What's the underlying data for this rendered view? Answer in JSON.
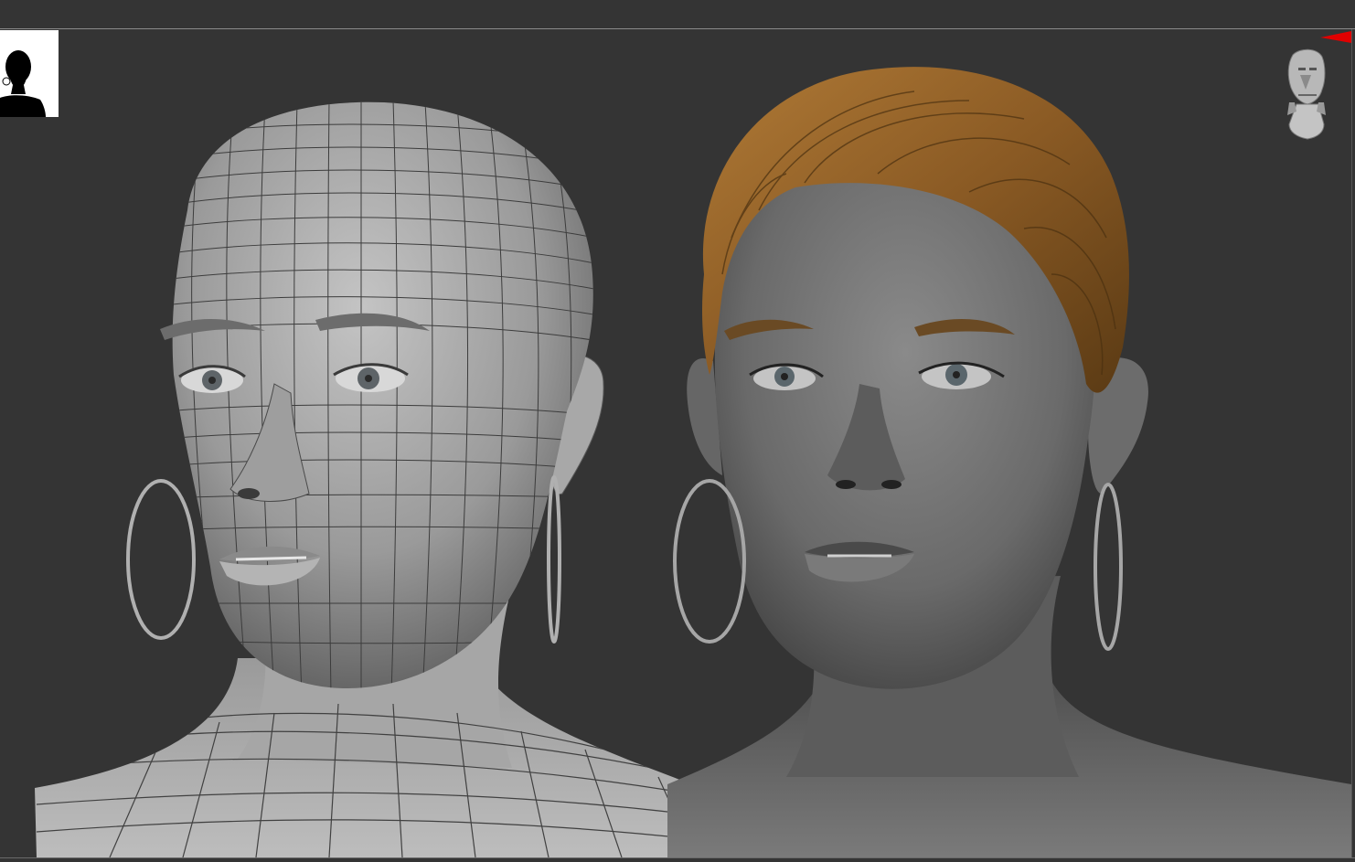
{
  "viewport": {
    "background_color": "#343434",
    "rule_color": "#8a8a8a"
  },
  "thumbnail": {
    "icon": "person-silhouette-icon",
    "background_color": "#ffffff",
    "silhouette_color": "#000000"
  },
  "nav_gizmo": {
    "icon": "head-navigation-gizmo-icon",
    "color": "#b8b8b8"
  },
  "corner_marker": {
    "icon": "red-flag-icon",
    "color": "#e00000"
  },
  "models": {
    "wireframe_head": {
      "display": "polyframe-wireframe",
      "material_color": "#9a9a9a",
      "wire_color": "#3a3a3a",
      "earring": "hoop"
    },
    "textured_head": {
      "display": "shaded-with-hair",
      "material_color": "#6e6e6e",
      "hair_color": "#9a6a30",
      "earring": "hoop"
    }
  }
}
